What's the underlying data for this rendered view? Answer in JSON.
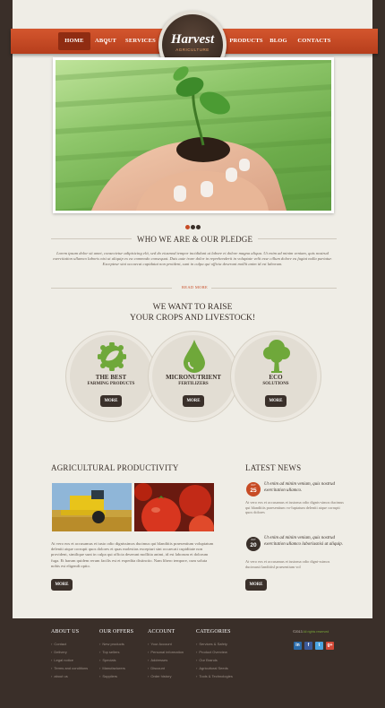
{
  "nav": {
    "left": [
      {
        "label": "HOME"
      },
      {
        "label": "ABOUT"
      },
      {
        "label": "SERVICES"
      }
    ],
    "right": [
      {
        "label": "PRODUCTS"
      },
      {
        "label": "BLOG"
      },
      {
        "label": "CONTACTS"
      }
    ],
    "active": "HOME"
  },
  "logo": {
    "title": "Harvest",
    "subtitle": "AGRICULTURE"
  },
  "slider": {
    "slides": 3,
    "active_slide": 1
  },
  "about": {
    "title": "WHO WE ARE & OUR PLEDGE",
    "text": "Lorem ipsum dolor sit amet, consectetur adipisicing elit, sed do eiusmod tempor incididunt ut labore et dolore magna aliqua. Ut enim ad minim veniam, quis nostrud exercitation ullamco laboris nisi ut aliquip ex ea commodo consequat. Duis aute irure dolor in reprehenderit in voluptate velit esse cillum dolore eu fugiat nulla pariatur. Excepteur sint occaecat cupidatat non proident, sunt in culpa qui officia deserunt mollit anim id est laborum.",
    "read_more": "READ MORE"
  },
  "raise": {
    "line1": "WE WANT TO RAISE",
    "line2": "YOUR CROPS AND LIVESTOCK!"
  },
  "features": [
    {
      "title": "THE BEST",
      "subtitle": "FARMING PRODUCTS",
      "button": "MORE",
      "icon": "leaf-badge-icon"
    },
    {
      "title": "MICRONUTRIENT",
      "subtitle": "FERTILIZERS",
      "button": "MORE",
      "icon": "droplet-icon"
    },
    {
      "title": "ECO",
      "subtitle": "SOLUTIONS",
      "button": "MORE",
      "icon": "tree-icon"
    }
  ],
  "productivity": {
    "title": "AGRICULTURAL PRODUCTIVITY",
    "text": "At vero eos et accusamus et iusto odio dignissimos ducimus qui blanditiis praesentium voluptatum deleniti atque corrupti quos dolores et quas molestias excepturi sint occaecati cupiditate non provident, similique sunt in culpa qui officia deserunt mollitia animi, id est laborum et dolorum fuga. Et harum quidem rerum facilis est et expedita distinctio. Nam libero tempore, cum soluta nobis est eligendi optio.",
    "button": "MORE"
  },
  "news": {
    "title": "LATEST NEWS",
    "items": [
      {
        "month": "OCT",
        "day": "25",
        "headline": "Ut enim ad minim veniam, quis nostrud exercitation ullamco.",
        "text": "At vero eos et accusamus et iustoma odio dignis-simos ducimus qui blanditiis praesentium vo-luptatum deleniti atque corrupti quos dolores"
      },
      {
        "month": "OCT",
        "day": "20",
        "headline": "Ut enim ad minim veniam, quis nostrud exercitation ullamco laboriusnisi ut aliquip.",
        "text": "At vero eos et accusamus et iustoma odio digni-ssimos ducimusti landitiisl praesentium vol"
      }
    ],
    "button": "MORE"
  },
  "footer": {
    "columns": [
      {
        "title": "ABOUT US",
        "items": [
          "Contact",
          "Delivery",
          "Legal notice",
          "Terms and conditions",
          "about us"
        ]
      },
      {
        "title": "OUR OFFERS",
        "items": [
          "New products",
          "Top sellers",
          "Specials",
          "Manufacturers",
          "Suppliers"
        ]
      },
      {
        "title": "ACCOUNT",
        "items": [
          "Your Account",
          "Personal information",
          "Addresses",
          "Discount",
          "Order history"
        ]
      },
      {
        "title": "CATEGORIES",
        "items": [
          "Services & Safety",
          "Product Overview",
          "Our Brands",
          "Agricultural Seeds",
          "Tools & Technologies"
        ]
      }
    ],
    "copyright": "©2013",
    "rights": "All rights reserved",
    "social": [
      "in",
      "f",
      "t",
      "g+"
    ]
  },
  "colors": {
    "accent": "#c74b25",
    "dark": "#3a302a",
    "page": "#efede6",
    "green": "#6fa83a"
  }
}
